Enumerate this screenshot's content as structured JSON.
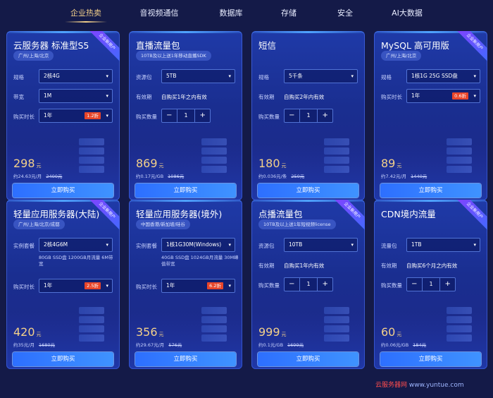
{
  "tabs": [
    "企业热卖",
    "音视频通信",
    "数据库",
    "存储",
    "安全",
    "AI大数据"
  ],
  "ribbon_label": "企业新用户",
  "buy_label": "立即购买",
  "cards": [
    {
      "title": "云服务器 标准型S5",
      "region": "广州/上海/北京",
      "ribbon": true,
      "rows": [
        {
          "label": "规格",
          "type": "select",
          "value": "2核4G"
        },
        {
          "label": "带宽",
          "type": "select",
          "value": "1M"
        },
        {
          "label": "购买时长",
          "type": "select",
          "value": "1年",
          "discount": "1.2折"
        }
      ],
      "price": "298",
      "unit": "元",
      "price_note": "约24.63元/月",
      "orig": "2400元"
    },
    {
      "title": "直播流量包",
      "region": "10TB及以上送1年移动直播SDK",
      "ribbon": false,
      "rows": [
        {
          "label": "资源包",
          "type": "select",
          "value": "5TB"
        },
        {
          "label": "有效期",
          "type": "text",
          "value": "自购买1年之内有效"
        },
        {
          "label": "购买数量",
          "type": "stepper",
          "value": "1"
        }
      ],
      "price": "869",
      "unit": "元",
      "price_note": "约0.17元/GB",
      "orig": "1086元"
    },
    {
      "title": "短信",
      "region": "",
      "ribbon": false,
      "rows": [
        {
          "label": "规格",
          "type": "select",
          "value": "5千条"
        },
        {
          "label": "有效期",
          "type": "text",
          "value": "自购买2年内有效"
        },
        {
          "label": "购买数量",
          "type": "stepper",
          "value": "1"
        }
      ],
      "price": "180",
      "unit": "元",
      "price_note": "约0.036元/条",
      "orig": "250元"
    },
    {
      "title": "MySQL 高可用版",
      "region": "广州/上海/北京",
      "ribbon": true,
      "rows": [
        {
          "label": "规格",
          "type": "select",
          "value": "1核1G 25G SSD盘"
        },
        {
          "label": "购买时长",
          "type": "select",
          "value": "1年",
          "discount": "0.6折"
        }
      ],
      "price": "89",
      "unit": "元",
      "price_note": "约7.42元/月",
      "orig": "1440元"
    },
    {
      "title": "轻量应用服务器(大陆)",
      "region": "广州/上海/北京/成都",
      "ribbon": true,
      "rows": [
        {
          "label": "实例套餐",
          "type": "select",
          "value": "2核4G6M",
          "desc": "80GB SSD盘 1200GB月流量 6M带宽"
        },
        {
          "label": "购买时长",
          "type": "select",
          "value": "1年",
          "discount": "2.5折"
        }
      ],
      "price": "420",
      "unit": "元",
      "price_note": "约35元/月",
      "orig": "1680元"
    },
    {
      "title": "轻量应用服务器(境外)",
      "region": "中国香港/新加坡/硅谷",
      "ribbon": false,
      "rows": [
        {
          "label": "实例套餐",
          "type": "select",
          "value": "1核1G30M(Windows)",
          "desc": "40GB SSD盘 1024GB月流量 30M峰值带宽"
        },
        {
          "label": "购买时长",
          "type": "select",
          "value": "1年",
          "discount": "6.2折"
        }
      ],
      "price": "356",
      "unit": "元",
      "price_note": "约29.67元/月",
      "orig": "576元"
    },
    {
      "title": "点播流量包",
      "region": "10TB及以上送1年短视频license",
      "ribbon": true,
      "rows": [
        {
          "label": "资源包",
          "type": "select",
          "value": "10TB"
        },
        {
          "label": "有效期",
          "type": "text",
          "value": "自购买1年内有效"
        },
        {
          "label": "购买数量",
          "type": "stepper",
          "value": "1"
        }
      ],
      "price": "999",
      "unit": "元",
      "price_note": "约0.1元/GB",
      "orig": "1699元"
    },
    {
      "title": "CDN境内流量",
      "region": "",
      "ribbon": true,
      "rows": [
        {
          "label": "流量包",
          "type": "select",
          "value": "1TB"
        },
        {
          "label": "有效期",
          "type": "text",
          "value": "自购买6个月之内有效"
        },
        {
          "label": "购买数量",
          "type": "stepper",
          "value": "1"
        }
      ],
      "price": "60",
      "unit": "元",
      "price_note": "约0.06元/GB",
      "orig": "184元"
    }
  ],
  "watermark": {
    "red": "云服务器网",
    "blue": "www.yuntue.com"
  }
}
